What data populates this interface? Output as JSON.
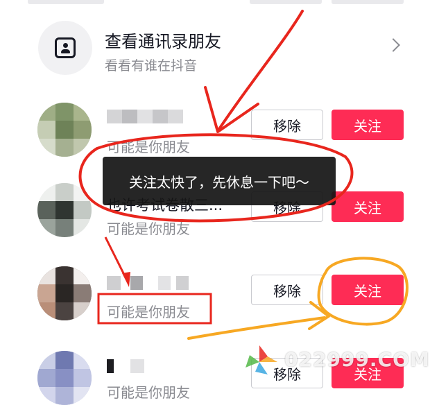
{
  "contacts_entry": {
    "title": "查看通讯录朋友",
    "subtitle": "看看有谁在抖音"
  },
  "suggestions": [
    {
      "subtitle": "可能是你朋友",
      "remove_label": "移除",
      "follow_label": "关注"
    },
    {
      "name_partial": "也许考试卷散三...",
      "subtitle": "可能是你朋友",
      "remove_label": "移除",
      "follow_label": "关注"
    },
    {
      "subtitle": "可能是你朋友",
      "remove_label": "移除",
      "follow_label": "关注"
    },
    {
      "subtitle": "可能是你朋友",
      "remove_label": "移除",
      "follow_label": "关注"
    }
  ],
  "toast": {
    "text": "关注太快了，先休息一下吧～"
  },
  "watermark": {
    "text": "022999.COM"
  },
  "colors": {
    "follow_button": "#fe2c55",
    "annotation_red": "#e8261d",
    "annotation_orange": "#f7a823"
  }
}
